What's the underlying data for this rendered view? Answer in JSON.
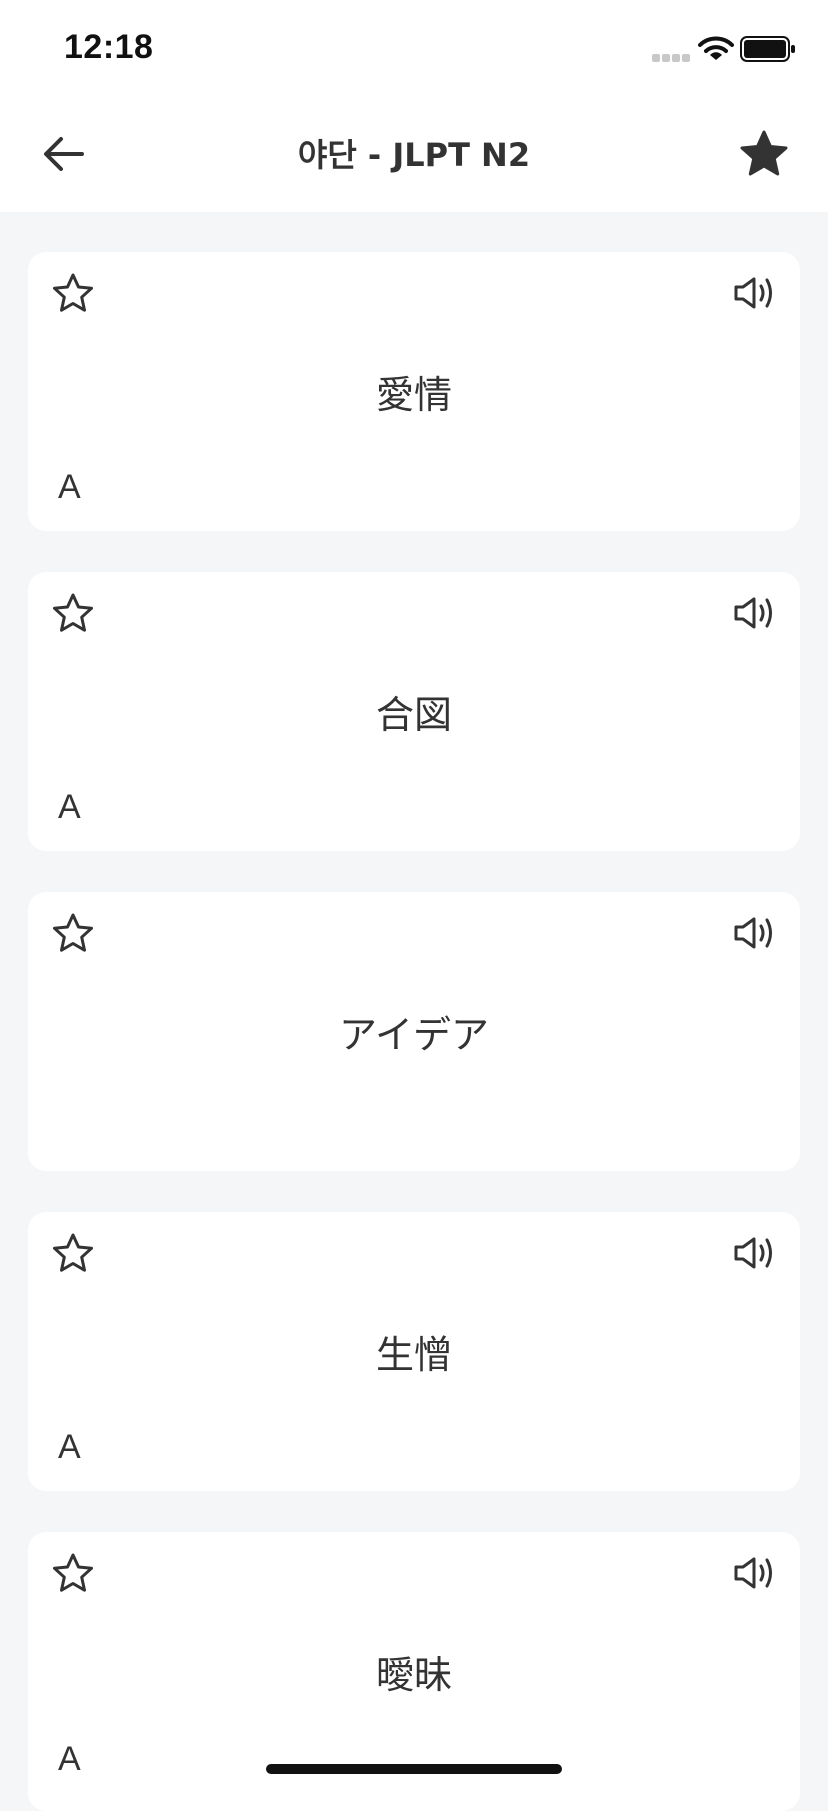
{
  "status_bar": {
    "time": "12:18",
    "icons": [
      "signal-icon",
      "wifi-icon",
      "battery-icon"
    ]
  },
  "header": {
    "title": "야단 - JLPT N2",
    "back_icon": "arrow-left-icon",
    "favorites_icon": "star-filled-icon"
  },
  "cards": [
    {
      "word": "愛情",
      "letter": "A"
    },
    {
      "word": "合図",
      "letter": "A"
    },
    {
      "word": "アイデア",
      "letter": ""
    },
    {
      "word": "生憎",
      "letter": "A"
    },
    {
      "word": "曖昧",
      "letter": "A"
    }
  ],
  "colors": {
    "background": "#f5f6f8",
    "card": "#ffffff",
    "text": "#333333"
  }
}
